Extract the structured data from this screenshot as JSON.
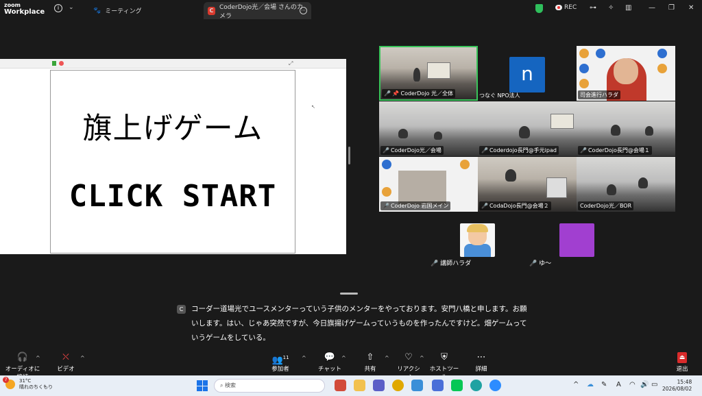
{
  "window": {
    "app_logo_line1": "zoom",
    "app_logo_line2": "Workplace",
    "info_glyph": "i",
    "caret_glyph": "⌄",
    "tabs": [
      {
        "label": "ミーティング",
        "icon": "paw-icon",
        "icon_glyph": "🐾"
      },
      {
        "label": "CoderDojo光／会場 さんのカメラ",
        "icon": "zoom-icon",
        "icon_glyph": "C",
        "more_glyph": "⋯"
      }
    ],
    "rec_label": "REC",
    "right_controls": {
      "dock_glyph": "⊶",
      "effects_glyph": "✧",
      "layout_glyph": "▥",
      "minimize_glyph": "—",
      "restore_glyph": "❐",
      "close_glyph": "✕"
    }
  },
  "share": {
    "game_title": "旗上げゲーム",
    "start_label": "CLICK START",
    "fullscreen_glyph": "⤢",
    "cursor_glyph": "↖"
  },
  "gallery": {
    "tiles": [
      {
        "label": "CoderDojo 光／全体",
        "muted": true,
        "pinned": true
      },
      {
        "label": "つなぐ NPO法人",
        "muted": false
      },
      {
        "label": "司会進行ハラダ",
        "muted": false
      },
      {
        "label": "CoderDojo光／会場",
        "muted": true
      },
      {
        "label": "Coderdojo長門@手元ipad",
        "muted": true
      },
      {
        "label": "CoderDojo長門@会場１",
        "muted": true
      },
      {
        "label": "CoderDojo 岩国メイン",
        "muted": true
      },
      {
        "label": "CodaDojo長門@会場２",
        "muted": true
      },
      {
        "label": "CoderDojo光／BOR",
        "muted": false
      }
    ],
    "n_initial": "n",
    "mic_glyph": "🎤",
    "pin_glyph": "📌",
    "extra": [
      {
        "label": "講師ハラダ",
        "muted": true
      },
      {
        "label": "ゆ〜",
        "muted": true
      }
    ]
  },
  "caption": {
    "badge": "C",
    "text": "コーダー道場光でユースメンターっていう子供のメンターをやっております。安門八橋と申します。お願いします。はい、じゃあ突然ですが、今日旗揚げゲームっていうものを作ったんですけど。畑ゲームっていうゲームをしている。"
  },
  "toolbar": {
    "audio": {
      "label": "オーディオに接続",
      "icon": "headphones-icon",
      "glyph": "🎧"
    },
    "video": {
      "label": "ビデオ",
      "icon": "video-off-icon",
      "glyph": "⛌"
    },
    "participants": {
      "label": "参加者",
      "count": "11",
      "icon": "participants-icon",
      "glyph": "👥"
    },
    "chat": {
      "label": "チャット",
      "icon": "chat-icon",
      "glyph": "💬"
    },
    "share": {
      "label": "共有",
      "icon": "share-icon",
      "glyph": "⇧"
    },
    "reactions": {
      "label": "リアクション",
      "icon": "heart-icon",
      "glyph": "♡"
    },
    "host_tools": {
      "label": "ホストツール",
      "icon": "shield-icon",
      "glyph": "⛨"
    },
    "more": {
      "label": "詳細",
      "icon": "more-icon",
      "glyph": "⋯"
    },
    "leave": {
      "label": "退出",
      "icon": "leave-icon",
      "glyph": "⏏"
    },
    "caret_glyph": "^"
  },
  "taskbar": {
    "weather_badge": "7",
    "temperature": "31°C",
    "weather_desc": "晴れのちくもり",
    "search_placeholder": "検索",
    "search_glyph": "⌕",
    "tray_up_glyph": "^",
    "cloud_glyph": "☁",
    "pen_glyph": "✎",
    "lang_glyph": "A",
    "wifi_glyph": "◠",
    "volume_glyph": "🔊",
    "battery_glyph": "▭",
    "time": "15:48",
    "date": "2026/08/02",
    "colors": {
      "accent": "#1a73e8",
      "zoom_red": "#d93a2e",
      "active_speaker": "#39c55a"
    }
  }
}
